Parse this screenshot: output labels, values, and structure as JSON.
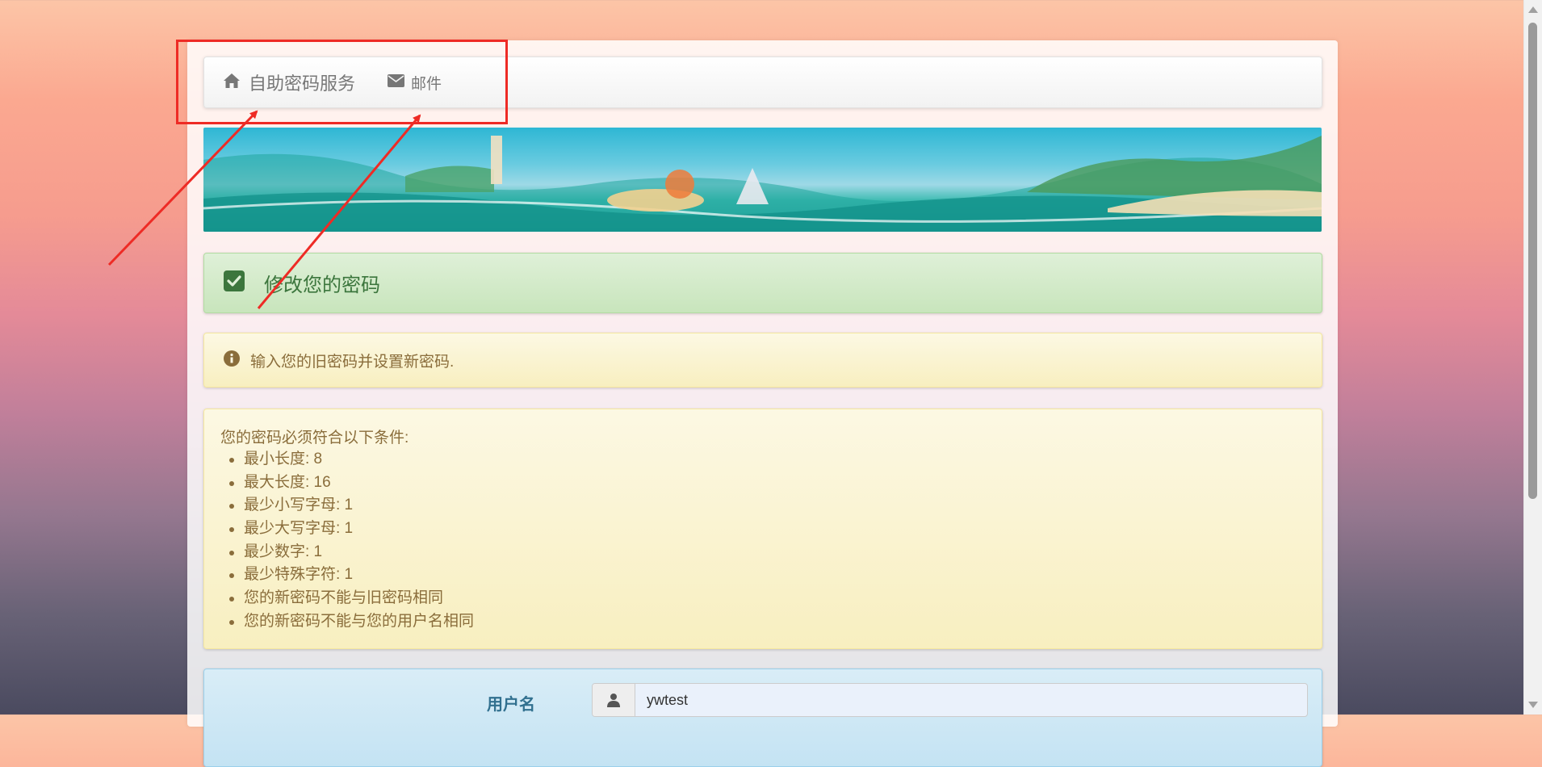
{
  "navbar": {
    "brand_label": "自助密码服务",
    "brand_icon": "home-icon",
    "mail_label": "邮件",
    "mail_icon": "envelope-icon"
  },
  "banner": {
    "description_icon": "decorative-banner"
  },
  "success_panel": {
    "title": "修改您的密码",
    "icon": "checkbox-icon"
  },
  "info_panel": {
    "text": "输入您的旧密码并设置新密码.",
    "icon": "info-circle-icon"
  },
  "policy": {
    "heading": "您的密码必须符合以下条件:",
    "items": [
      "最小长度: 8",
      "最大长度: 16",
      "最少小写字母: 1",
      "最少大写字母: 1",
      "最少数字: 1",
      "最少特殊字符: 1",
      "您的新密码不能与旧密码相同",
      "您的新密码不能与您的用户名相同"
    ]
  },
  "form": {
    "username_label": "用户名",
    "username_value": "ywtest",
    "username_icon": "user-icon"
  },
  "colors": {
    "annotation": "#ee2b25",
    "success_text": "#3c763d",
    "warning_text": "#8a6d3b",
    "info_label": "#31708f"
  }
}
